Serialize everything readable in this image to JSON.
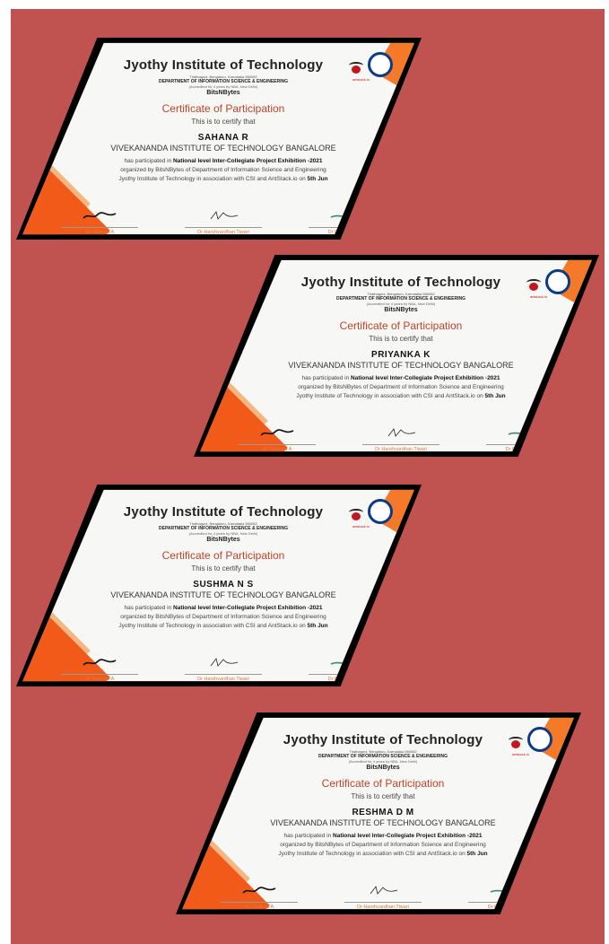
{
  "certificates": [
    {
      "institute": "Jyothy Institute of Technology",
      "address": "Thathaguni, Bengaluru, Karnataka 560082",
      "department": "DEPARTMENT OF INFORMATION SCIENCE & ENGINEERING",
      "accreditation": "(Accredited for 4 years by NBA, New Delhi)",
      "club": "BitsNBytes",
      "certificate_title": "Certificate of Participation",
      "certify_text": "This is to certify that",
      "participant_name": "SAHANA R",
      "college": "VIVEKANANDA INSTITUTE OF TECHNOLOGY BANGALORE",
      "participated_prefix": "has participated in ",
      "event_name": "National  level Inter-Collegiate Project Exhibition -2021",
      "organized_line": "organized by BitsNBytes of Department of Information Science and Engineering",
      "association_line": "Jyothy Institute of Technology in association with CSI and AntStack.io  on ",
      "date": "5th Jun",
      "logo_text": "antstack.io",
      "signatories": [
        {
          "name": "Mr Vadiraja A",
          "role": "Faculty Incharge"
        },
        {
          "name": "Dr Harshvardhan Tiwari",
          "role": "HoD-ISE"
        },
        {
          "name": "Dr  Gopalakrishna",
          "role": "Principal"
        }
      ]
    },
    {
      "institute": "Jyothy Institute of Technology",
      "address": "Thathaguni, Bengaluru, Karnataka 560082",
      "department": "DEPARTMENT OF INFORMATION SCIENCE & ENGINEERING",
      "accreditation": "(Accredited for 4 years by NBA, New Delhi)",
      "club": "BitsNBytes",
      "certificate_title": "Certificate of Participation",
      "certify_text": "This is to certify that",
      "participant_name": "PRIYANKA K",
      "college": "VIVEKANANDA INSTITUTE OF TECHNOLOGY BANGALORE",
      "participated_prefix": "has participated in ",
      "event_name": "National  level Inter-Collegiate Project Exhibition -2021",
      "organized_line": "organized by BitsNBytes of Department of Information Science and Engineering",
      "association_line": "Jyothy Institute of Technology in association with CSI and AntStack.io  on ",
      "date": "5th Jun",
      "logo_text": "antstack.io",
      "signatories": [
        {
          "name": "Mr Vadiraja A",
          "role": "Faculty Incharge"
        },
        {
          "name": "Dr Harshvardhan Tiwari",
          "role": "HoD-ISE"
        },
        {
          "name": "Dr  Gopalakrishna",
          "role": "Principal"
        }
      ]
    },
    {
      "institute": "Jyothy Institute of Technology",
      "address": "Thathaguni, Bengaluru, Karnataka 560082",
      "department": "DEPARTMENT OF INFORMATION SCIENCE & ENGINEERING",
      "accreditation": "(Accredited for 4 years by NBA, New Delhi)",
      "club": "BitsNBytes",
      "certificate_title": "Certificate of Participation",
      "certify_text": "This is to certify that",
      "participant_name": "SUSHMA N S",
      "college": "VIVEKANANDA INSTITUTE OF TECHNOLOGY BANGALORE",
      "participated_prefix": "has participated in ",
      "event_name": "National  level Inter-Collegiate Project Exhibition -2021",
      "organized_line": "organized by BitsNBytes of Department of Information Science and Engineering",
      "association_line": "Jyothy Institute of Technology in association with CSI and AntStack.io  on ",
      "date": "5th Jun",
      "logo_text": "antstack.io",
      "signatories": [
        {
          "name": "Mr Vadiraja A",
          "role": "Faculty Incharge"
        },
        {
          "name": "Dr Harshvardhan Tiwari",
          "role": "HoD-ISE"
        },
        {
          "name": "Dr  Gopalakrishna",
          "role": "Principal"
        }
      ]
    },
    {
      "institute": "Jyothy Institute of Technology",
      "address": "Thathaguni, Bengaluru, Karnataka 560082",
      "department": "DEPARTMENT OF INFORMATION SCIENCE & ENGINEERING",
      "accreditation": "(Accredited for 4 years by NBA, New Delhi)",
      "club": "BitsNBytes",
      "certificate_title": "Certificate of Participation",
      "certify_text": "This is to certify that",
      "participant_name": "RESHMA D M",
      "college": "VIVEKANANDA INSTITUTE OF TECHNOLOGY BANGALORE",
      "participated_prefix": "has participated in ",
      "event_name": "National  level Inter-Collegiate Project Exhibition -2021",
      "organized_line": "organized by BitsNBytes of Department of Information Science and Engineering",
      "association_line": "Jyothy Institute of Technology in association with CSI and AntStack.io  on ",
      "date": "5th Jun",
      "logo_text": "antstack.io",
      "signatories": [
        {
          "name": "Mr Vadiraja A",
          "role": "Faculty Incharge"
        },
        {
          "name": "Dr Harshvardhan Tiwari",
          "role": "HoD-ISE"
        },
        {
          "name": "Dr  Gopalakrishna",
          "role": "Principal"
        }
      ]
    }
  ],
  "colors": {
    "background": "#c0534f",
    "frame": "#000000",
    "accent_orange": "#f25a1a",
    "title_red": "#c0422a"
  }
}
